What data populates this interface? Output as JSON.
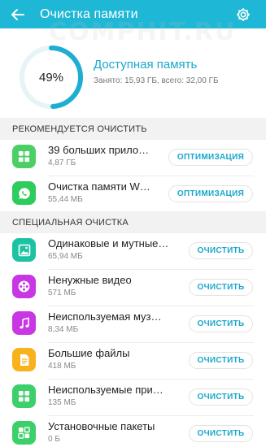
{
  "appbar": {
    "title": "Очистка памяти"
  },
  "watermark": "COMPHIT.RU",
  "summary": {
    "percent": 49,
    "percent_label": "49%",
    "title": "Доступная память",
    "subtitle": "Занято: 15,93 ГБ, всего: 32,00 ГБ"
  },
  "recommended": {
    "header": "РЕКОМЕНДУЕТСЯ ОЧИСТИТЬ",
    "items": [
      {
        "name": "39 больших прило…",
        "size": "4,87 ГБ",
        "button": "ОПТИМИЗАЦИЯ",
        "icon": "apps-grid-icon",
        "color": "#4cd065"
      },
      {
        "name": "Очистка памяти W…",
        "size": "55,44 МБ",
        "button": "ОПТИМИЗАЦИЯ",
        "icon": "whatsapp-icon",
        "color": "#2ecc5c"
      }
    ]
  },
  "special": {
    "header": "СПЕЦИАЛЬНАЯ ОЧИСТКА",
    "items": [
      {
        "name": "Одинаковые и мутные…",
        "size": "65,94 МБ",
        "button": "ОЧИСТИТЬ",
        "icon": "image-icon",
        "color": "#1cc3a3"
      },
      {
        "name": "Ненужные видео",
        "size": "571 МБ",
        "button": "ОЧИСТИТЬ",
        "icon": "film-reel-icon",
        "color": "#c837e3"
      },
      {
        "name": "Неиспользуемая муз…",
        "size": "8,34 МБ",
        "button": "ОЧИСТИТЬ",
        "icon": "music-note-icon",
        "color": "#c837e3"
      },
      {
        "name": "Большие файлы",
        "size": "418 МБ",
        "button": "ОЧИСТИТЬ",
        "icon": "document-icon",
        "color": "#f7b21c"
      },
      {
        "name": "Неиспользуемые при…",
        "size": "135 МБ",
        "button": "ОЧИСТИТЬ",
        "icon": "apps-grid-icon",
        "color": "#3ccf6a"
      },
      {
        "name": "Установочные пакеты",
        "size": "0 Б",
        "button": "ОЧИСТИТЬ",
        "icon": "package-icon",
        "color": "#3ccf6a"
      }
    ]
  }
}
